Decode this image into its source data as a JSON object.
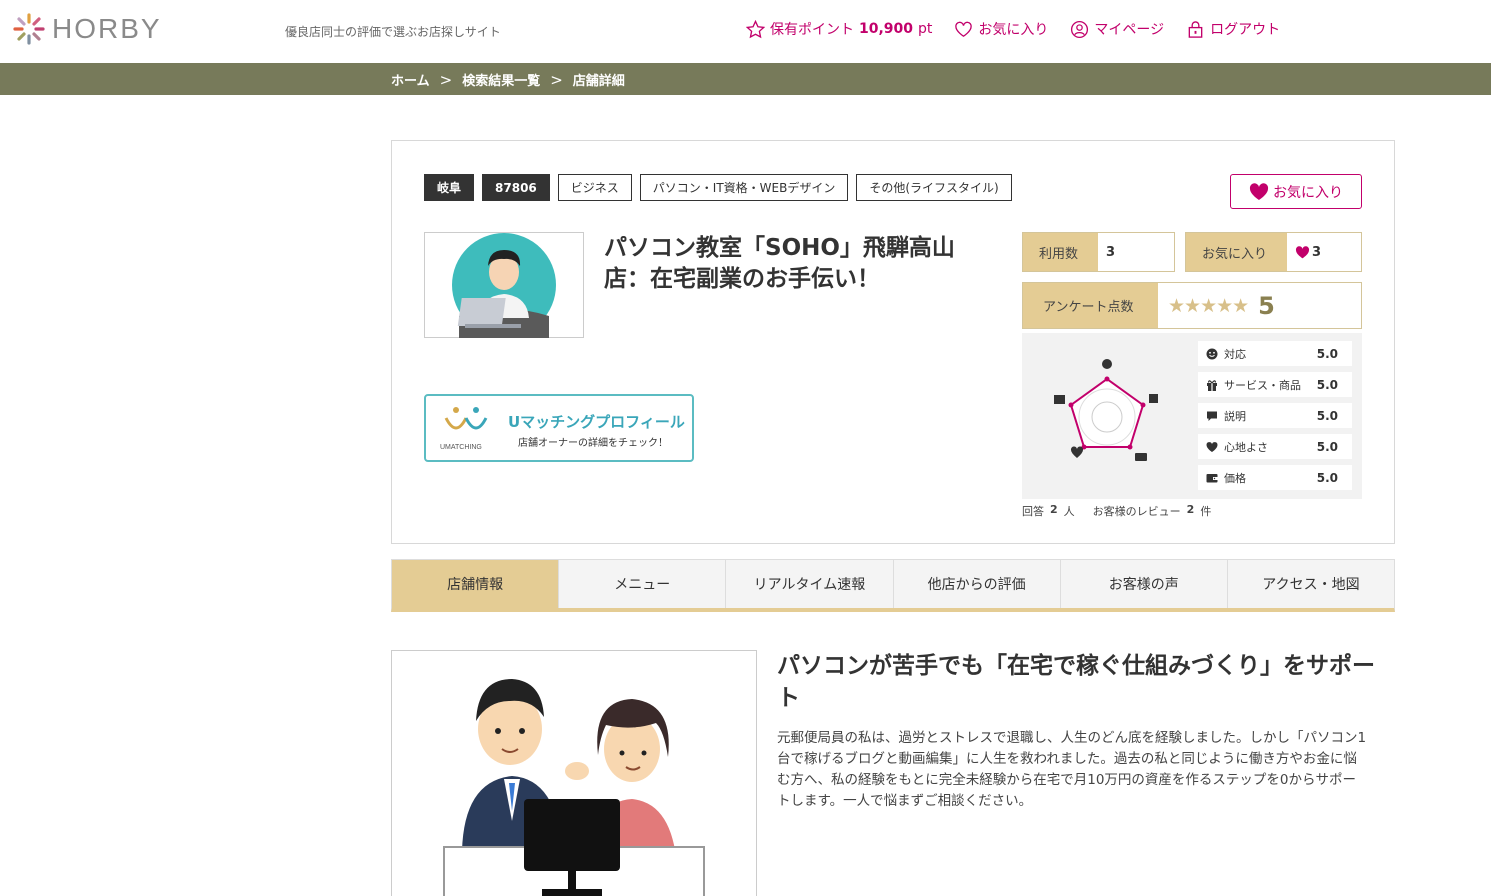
{
  "header": {
    "logo_text": "HORBY",
    "tagline": "優良店同士の評価で選ぶお店探しサイト",
    "points_label": "保有ポイント",
    "points_value": "10,900",
    "points_unit": "pt",
    "favorites": "お気に入り",
    "mypage": "マイページ",
    "logout": "ログアウト",
    "accent_color": "#c2006b"
  },
  "breadcrumb": {
    "items": [
      "ホーム",
      "検索結果一覧",
      "店舗詳細"
    ],
    "separator": ">"
  },
  "shop": {
    "tags": [
      "岐阜",
      "87806",
      "ビジネス",
      "パソコン・IT資格・WEBデザイン",
      "その他(ライフスタイル)"
    ],
    "title": "パソコン教室「SOHO」飛騨高山店：在宅副業のお手伝い！",
    "favorite_button": "お気に入り",
    "umatching": {
      "logo_text": "UMATCHING",
      "title": "Uマッチングプロフィール",
      "subtitle": "店舗オーナーの詳細をチェック！"
    }
  },
  "stats": {
    "usage_label": "利用数",
    "usage_value": "3",
    "fav_label": "お気に入り",
    "fav_value": "3",
    "survey_label": "アンケート点数",
    "survey_stars": "★★★★★",
    "survey_value": "5",
    "ratings": [
      {
        "icon": "smile-icon",
        "name": "対応",
        "score": "5.0"
      },
      {
        "icon": "gift-icon",
        "name": "サービス・商品",
        "score": "5.0"
      },
      {
        "icon": "speech-bubble-icon",
        "name": "説明",
        "score": "5.0"
      },
      {
        "icon": "heart-icon",
        "name": "心地よさ",
        "score": "5.0"
      },
      {
        "icon": "wallet-icon",
        "name": "価格",
        "score": "5.0"
      }
    ],
    "answers_label": "回答",
    "answers_count": "2",
    "answers_unit": "人",
    "reviews_label": "お客様のレビュー",
    "reviews_count": "2",
    "reviews_unit": "件"
  },
  "tabs": [
    {
      "label": "店舗情報",
      "active": true
    },
    {
      "label": "メニュー",
      "active": false
    },
    {
      "label": "リアルタイム速報",
      "active": false
    },
    {
      "label": "他店からの評価",
      "active": false
    },
    {
      "label": "お客様の声",
      "active": false
    },
    {
      "label": "アクセス・地図",
      "active": false
    }
  ],
  "content": {
    "title": "パソコンが苦手でも「在宅で稼ぐ仕組みづくり」をサポート",
    "body": "元郵便局員の私は、過労とストレスで退職し、人生のどん底を経験しました。しかし「パソコン1台で稼げるブログと動画編集」に人生を救われました。過去の私と同じように働き方やお金に悩む方へ、私の経験をもとに完全未経験から在宅で月10万円の資産を作るステップを0からサポートします。一人で悩まずご相談ください。"
  }
}
